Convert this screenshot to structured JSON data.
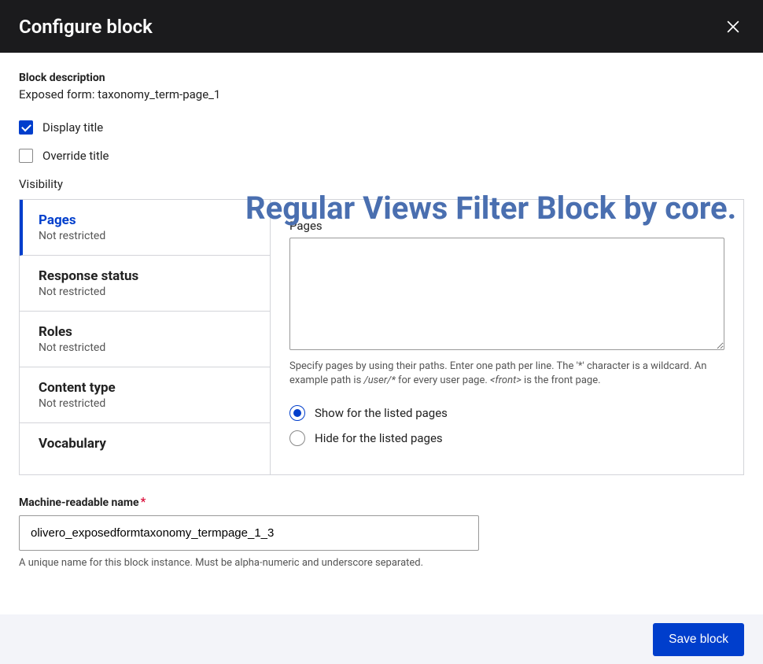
{
  "header": {
    "title": "Configure block"
  },
  "block": {
    "desc_label": "Block description",
    "desc_value": "Exposed form: taxonomy_term-page_1",
    "display_title_label": "Display title",
    "override_title_label": "Override title"
  },
  "overlay": {
    "text": "Regular Views Filter Block by core."
  },
  "visibility": {
    "heading": "Visibility",
    "tabs": [
      {
        "title": "Pages",
        "sub": "Not restricted",
        "active": true
      },
      {
        "title": "Response status",
        "sub": "Not restricted",
        "active": false
      },
      {
        "title": "Roles",
        "sub": "Not restricted",
        "active": false
      },
      {
        "title": "Content type",
        "sub": "Not restricted",
        "active": false
      },
      {
        "title": "Vocabulary",
        "sub": "",
        "active": false
      }
    ],
    "panel": {
      "label": "Pages",
      "textarea_value": "",
      "help_pre": "Specify pages by using their paths. Enter one path per line. The '*' character is a wildcard. An example path is ",
      "help_em1": "/user/*",
      "help_mid": " for every user page. ",
      "help_em2": "<front>",
      "help_post": " is the front page.",
      "radio_show": "Show for the listed pages",
      "radio_hide": "Hide for the listed pages"
    }
  },
  "machine": {
    "label": "Machine-readable name",
    "value": "olivero_exposedformtaxonomy_termpage_1_3",
    "help": "A unique name for this block instance. Must be alpha-numeric and underscore separated."
  },
  "footer": {
    "save": "Save block"
  }
}
